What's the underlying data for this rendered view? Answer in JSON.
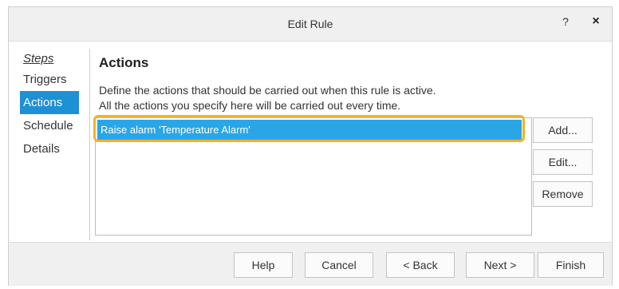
{
  "window": {
    "title": "Edit Rule",
    "help_icon": "?",
    "close_icon": "×"
  },
  "steps": {
    "heading": "Steps",
    "items": [
      {
        "label": "Triggers",
        "active": false
      },
      {
        "label": "Actions",
        "active": true
      },
      {
        "label": "Schedule",
        "active": false
      },
      {
        "label": "Details",
        "active": false
      }
    ]
  },
  "main": {
    "title": "Actions",
    "description_line1": "Define the actions that should be carried out when this rule is active.",
    "description_line2": "All the actions you specify here will be carried out every time.",
    "actions_list": [
      {
        "label": "Raise alarm 'Temperature Alarm'",
        "selected": true
      }
    ]
  },
  "side_buttons": {
    "add": "Add...",
    "edit": "Edit...",
    "remove": "Remove"
  },
  "footer": {
    "help": "Help",
    "cancel": "Cancel",
    "back": "< Back",
    "next": "Next >",
    "finish": "Finish"
  },
  "colors": {
    "active_step_bg": "#1e90d6",
    "selected_item_bg": "#2aa6e6",
    "highlight_border": "#f3b22a"
  }
}
